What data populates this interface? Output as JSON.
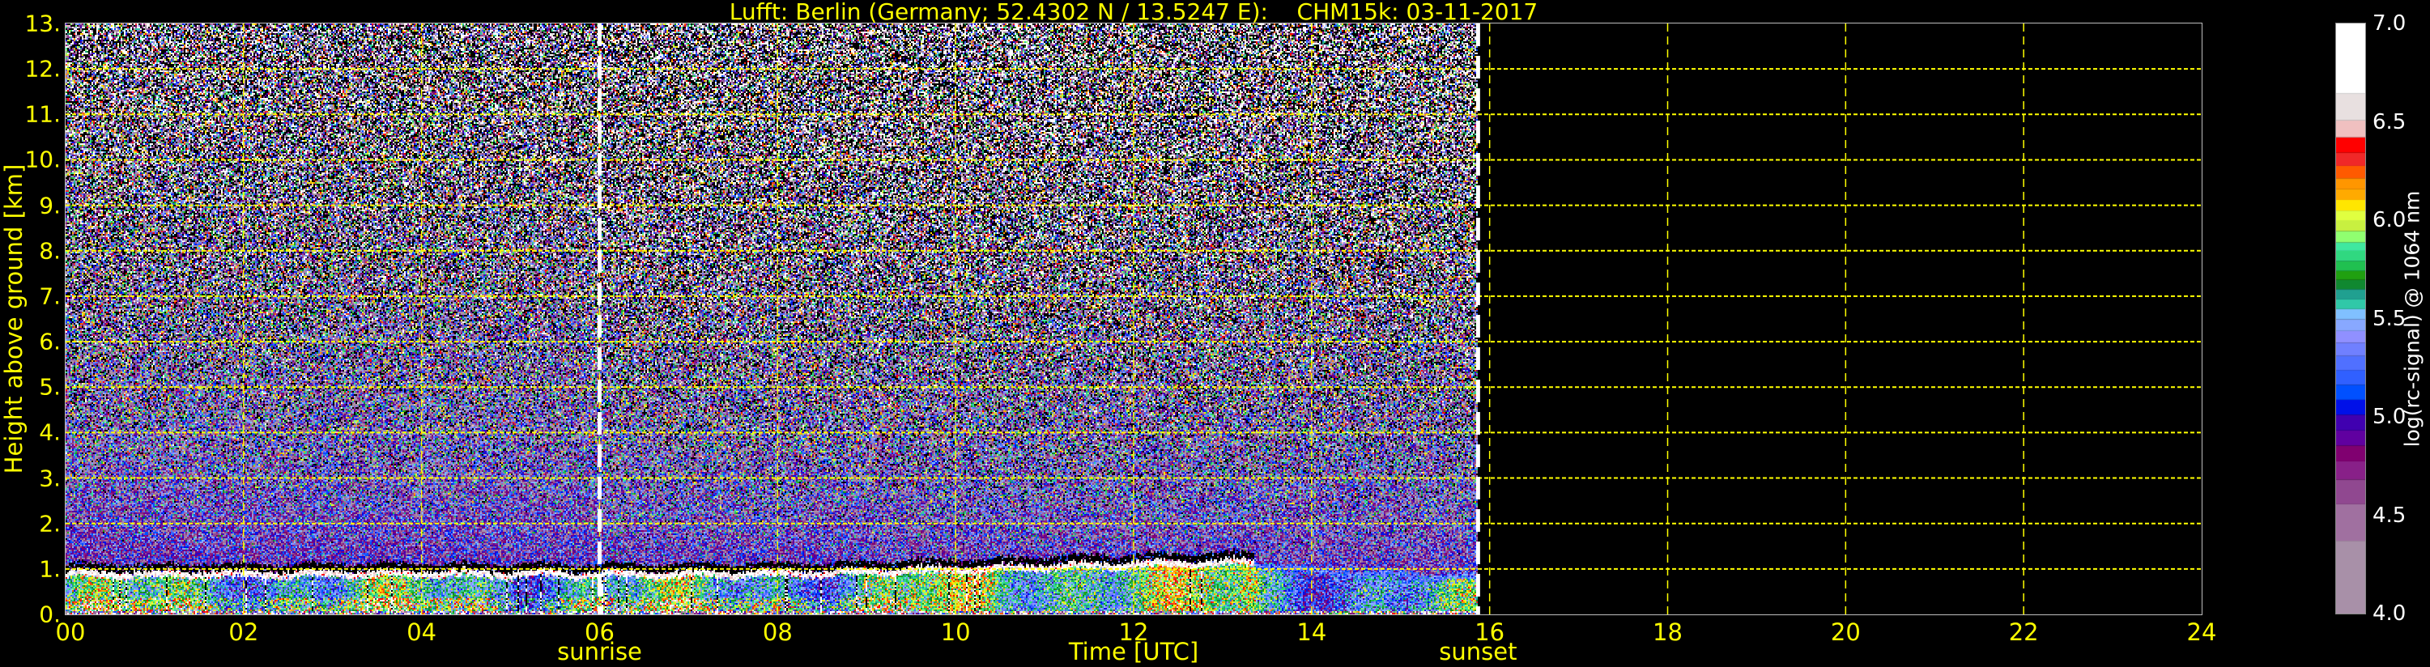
{
  "chart_data": {
    "type": "heatmap",
    "title": "Lufft: Berlin (Germany; 52.4302 N / 13.5247 E):    CHM15k: 03-11-2017",
    "xlabel": "Time [UTC]",
    "ylabel": "Height above ground [km]",
    "xlim": [
      0,
      24
    ],
    "ylim": [
      0,
      13
    ],
    "x_ticks": [
      "00",
      "02",
      "04",
      "06",
      "08",
      "10",
      "12",
      "14",
      "16",
      "18",
      "20",
      "22",
      "24"
    ],
    "y_ticks": [
      "0.",
      "1.",
      "2.",
      "3.",
      "4.",
      "5.",
      "6.",
      "7.",
      "8.",
      "9.",
      "10.",
      "11.",
      "12.",
      "13."
    ],
    "grid": true,
    "grid_color": "#ffff00",
    "data_end_hour": 15.86,
    "markers": [
      {
        "label": "sunrise",
        "hour": 6.0
      },
      {
        "label": "sunset",
        "hour": 15.87
      }
    ],
    "boundary_layer_top_km": {
      "hours": [
        0,
        8,
        10,
        12,
        13.3,
        14,
        15.86
      ],
      "heights": [
        0.95,
        0.95,
        1.05,
        1.15,
        1.2,
        1.0,
        0.85
      ]
    },
    "colorbar": {
      "label": "log(rc-signal) @ 1064 nm",
      "range": [
        4.0,
        7.0
      ],
      "ticks": [
        "7.0",
        "6.5",
        "6.0",
        "5.5",
        "5.0",
        "4.5",
        "4.0"
      ],
      "under_color": "#000000",
      "over_color": "#ffffff",
      "bands": [
        {
          "from": 4.0,
          "to": 4.37,
          "color": "#a890a8"
        },
        {
          "from": 4.37,
          "to": 4.556,
          "color": "#a070a0"
        },
        {
          "from": 4.556,
          "to": 4.681,
          "color": "#904890"
        },
        {
          "from": 4.681,
          "to": 4.774,
          "color": "#882088"
        },
        {
          "from": 4.774,
          "to": 4.854,
          "color": "#800070"
        },
        {
          "from": 4.854,
          "to": 4.931,
          "color": "#6000a0"
        },
        {
          "from": 4.931,
          "to": 5.011,
          "color": "#4000b0"
        },
        {
          "from": 5.011,
          "to": 5.087,
          "color": "#0010e8"
        },
        {
          "from": 5.087,
          "to": 5.163,
          "color": "#0050ff"
        },
        {
          "from": 5.163,
          "to": 5.238,
          "color": "#3060ff"
        },
        {
          "from": 5.238,
          "to": 5.31,
          "color": "#5070ff"
        },
        {
          "from": 5.31,
          "to": 5.377,
          "color": "#7080ff"
        },
        {
          "from": 5.377,
          "to": 5.437,
          "color": "#9090ff"
        },
        {
          "from": 5.437,
          "to": 5.496,
          "color": "#88a8ff"
        },
        {
          "from": 5.496,
          "to": 5.548,
          "color": "#80c0ff"
        },
        {
          "from": 5.548,
          "to": 5.597,
          "color": "#30c8a8"
        },
        {
          "from": 5.597,
          "to": 5.649,
          "color": "#20a090"
        },
        {
          "from": 5.649,
          "to": 5.697,
          "color": "#108830"
        },
        {
          "from": 5.697,
          "to": 5.742,
          "color": "#20a010"
        },
        {
          "from": 5.742,
          "to": 5.792,
          "color": "#20c050"
        },
        {
          "from": 5.792,
          "to": 5.844,
          "color": "#30d880"
        },
        {
          "from": 5.844,
          "to": 5.887,
          "color": "#40e8a0"
        },
        {
          "from": 5.887,
          "to": 5.945,
          "color": "#90ff70"
        },
        {
          "from": 5.945,
          "to": 6.0,
          "color": "#c8f040"
        },
        {
          "from": 6.0,
          "to": 6.049,
          "color": "#e0ff40"
        },
        {
          "from": 6.049,
          "to": 6.103,
          "color": "#ffe600"
        },
        {
          "from": 6.103,
          "to": 6.157,
          "color": "#ffaa00"
        },
        {
          "from": 6.157,
          "to": 6.213,
          "color": "#ff9600"
        },
        {
          "from": 6.213,
          "to": 6.276,
          "color": "#ff5a00"
        },
        {
          "from": 6.276,
          "to": 6.343,
          "color": "#f02828"
        },
        {
          "from": 6.343,
          "to": 6.421,
          "color": "#ff0000"
        },
        {
          "from": 6.421,
          "to": 6.507,
          "color": "#f0c0c0"
        },
        {
          "from": 6.507,
          "to": 6.643,
          "color": "#e8e0e0"
        },
        {
          "from": 6.643,
          "to": 7.0,
          "color": "#ffffff"
        }
      ]
    }
  }
}
